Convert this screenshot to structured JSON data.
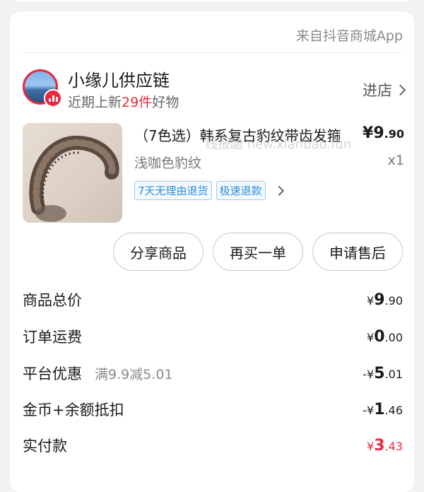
{
  "source": "来自抖音商城App",
  "store": {
    "name": "小缘儿供应链",
    "sub_prefix": "近期上新",
    "sub_count": "29件",
    "sub_suffix": "好物",
    "enter_label": "进店"
  },
  "product": {
    "title": "（7色选）韩系复古豹纹带齿发箍",
    "watermark": "线报酷 new.xianbao.fun",
    "price_currency": "¥",
    "price_int": "9",
    "price_dec": ".90",
    "spec": "浅咖色豹纹",
    "qty": "x1",
    "tags": [
      "7天无理由退货",
      "极速退款"
    ]
  },
  "actions": {
    "share": "分享商品",
    "rebuy": "再买一单",
    "aftersale": "申请售后"
  },
  "summary": [
    {
      "label": "商品总价",
      "note": "",
      "prefix": "¥",
      "int": "9",
      "dec": ".90"
    },
    {
      "label": "订单运费",
      "note": "",
      "prefix": "¥",
      "int": "0",
      "dec": ".00"
    },
    {
      "label": "平台优惠",
      "note": "满9.9减5.01",
      "prefix": "-¥",
      "int": "5",
      "dec": ".01"
    },
    {
      "label": "金币+余额抵扣",
      "note": "",
      "prefix": "-¥",
      "int": "1",
      "dec": ".46"
    },
    {
      "label": "实付款",
      "note": "",
      "prefix": "¥",
      "int": "3",
      "dec": ".43"
    }
  ],
  "colors": {
    "accent": "#e8283f",
    "tag_blue": "#2d8fd6"
  }
}
